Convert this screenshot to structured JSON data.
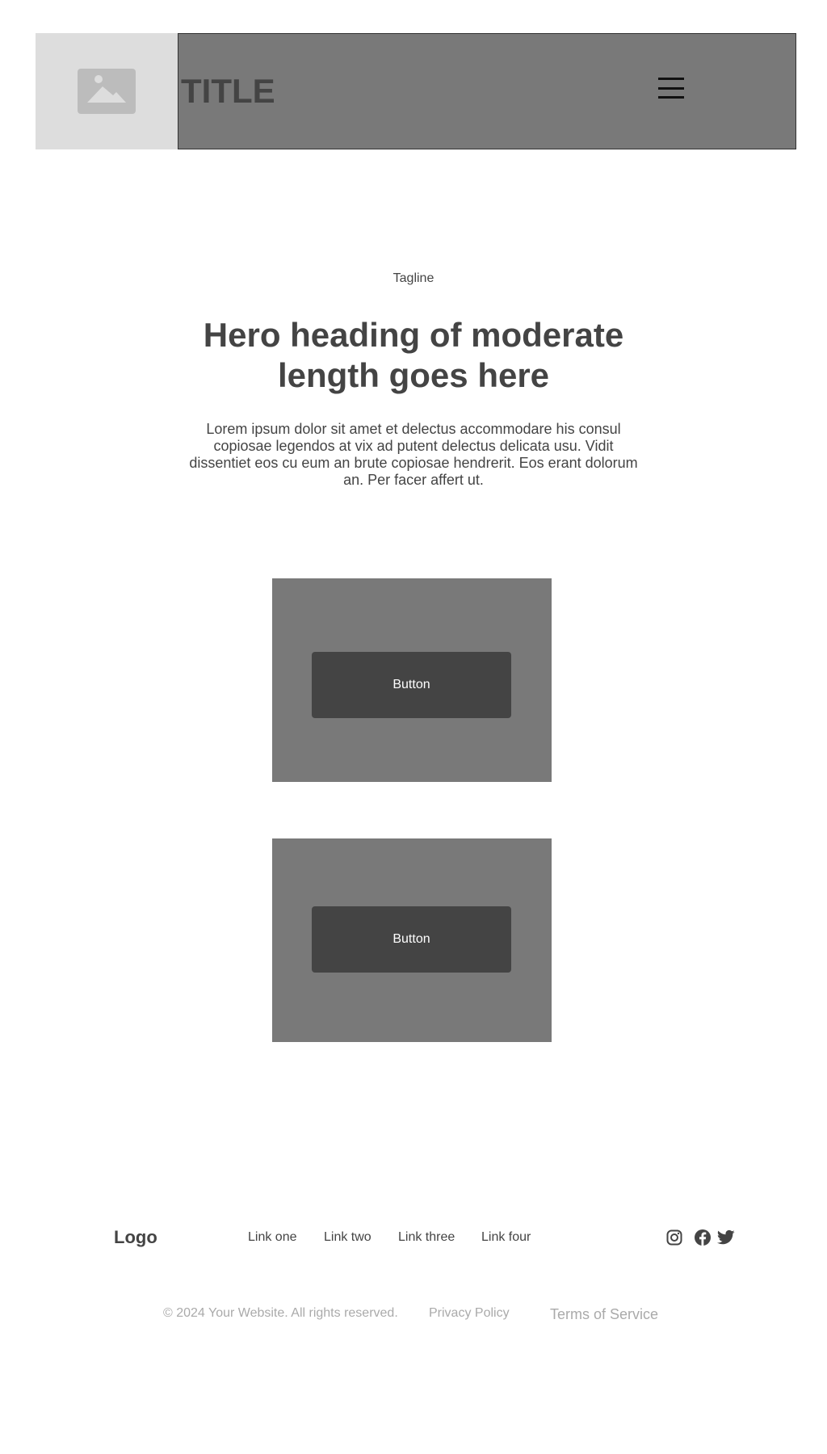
{
  "header": {
    "title": "TITLE"
  },
  "hero": {
    "tagline": "Tagline",
    "heading": "Hero heading of moderate length goes here",
    "body": "Lorem ipsum dolor sit amet et delectus accommodare his consul copiosae legendos at vix ad putent delectus delicata usu. Vidit dissentiet eos cu eum an brute copiosae hendrerit. Eos erant dolorum an. Per facer affert ut."
  },
  "cards": [
    {
      "button_label": "Button"
    },
    {
      "button_label": "Button"
    }
  ],
  "footer": {
    "logo": "Logo",
    "links": [
      "Link one",
      "Link two",
      "Link three",
      "Link four"
    ],
    "social_icons": [
      "instagram-icon",
      "facebook-icon",
      "twitter-icon"
    ],
    "copyright": "© 2024 Your Website. All rights reserved.",
    "privacy": "Privacy Policy",
    "terms": "Terms of Service"
  },
  "colors": {
    "header_bar": "#797979",
    "image_placeholder": "#dddddd",
    "card": "#797979",
    "button": "#444444",
    "text": "#444444",
    "muted_text": "#aaaaaa"
  }
}
